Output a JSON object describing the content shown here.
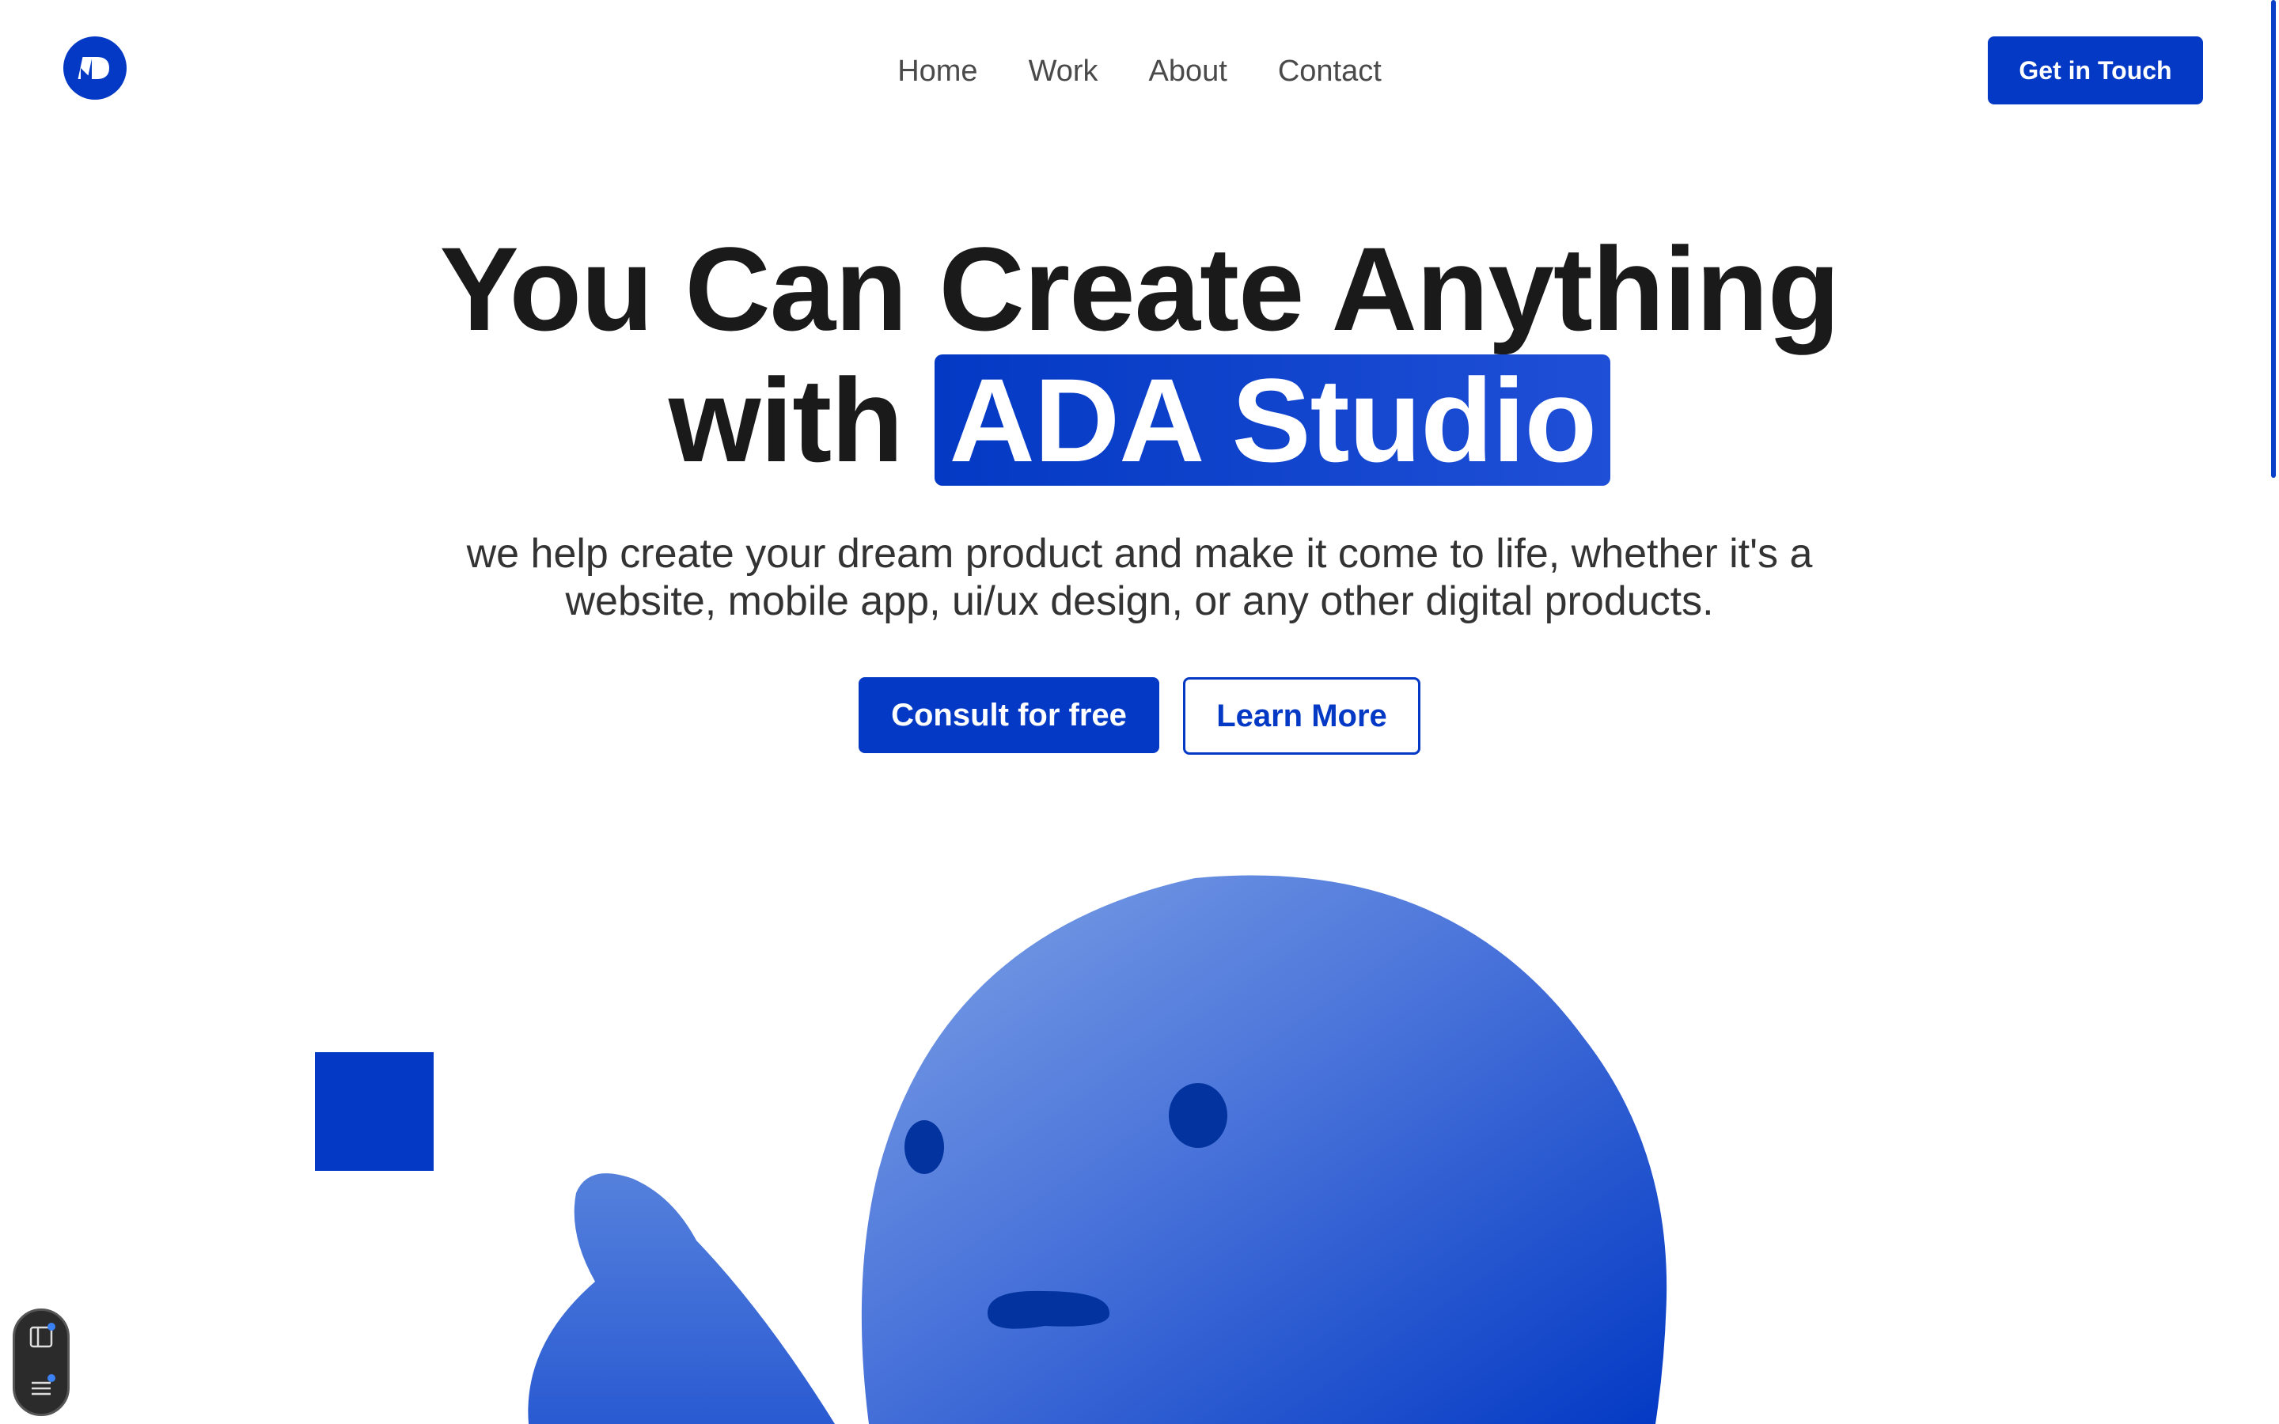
{
  "brand": {
    "logo": "ada-logo-icon",
    "accent": "#0339c4"
  },
  "nav": {
    "items": [
      {
        "label": "Home"
      },
      {
        "label": "Work"
      },
      {
        "label": "About"
      },
      {
        "label": "Contact"
      }
    ],
    "cta_label": "Get in Touch"
  },
  "hero": {
    "title_line1": "You Can Create Anything",
    "title_prefix": "with",
    "title_highlight": "ADA Studio",
    "subtitle_line1": "we help create your dream product and make it come to life, whether it's a",
    "subtitle_line2": "website, mobile app, ui/ux design, or any other digital products.",
    "primary_button": "Consult for free",
    "secondary_button": "Learn More"
  },
  "illustration": {
    "character": "blue-blob-character",
    "colors": {
      "light": "#7399e3",
      "dark": "#0339c4",
      "feature": "#02339e"
    }
  },
  "toolbar": {
    "icons": [
      "sidebar-panel-icon",
      "menu-list-icon"
    ],
    "dot_color": "#3b82f6"
  }
}
